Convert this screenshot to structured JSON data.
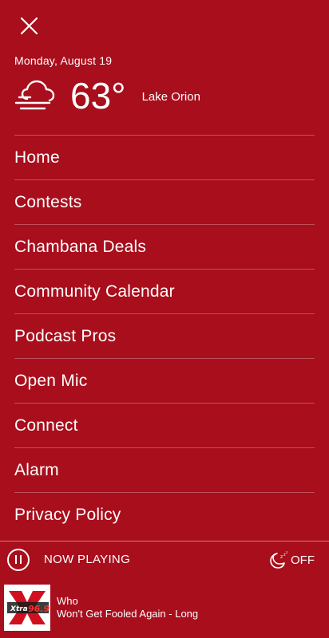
{
  "header": {
    "close_icon": "close-icon"
  },
  "weather": {
    "date": "Monday, August 19",
    "icon": "cloudy-fog-icon",
    "temperature": "63°",
    "location": "Lake Orion"
  },
  "menu": {
    "items": [
      {
        "label": "Home"
      },
      {
        "label": "Contests"
      },
      {
        "label": "Chambana Deals"
      },
      {
        "label": "Community Calendar"
      },
      {
        "label": "Podcast Pros"
      },
      {
        "label": "Open Mic"
      },
      {
        "label": "Connect"
      },
      {
        "label": "Alarm"
      },
      {
        "label": "Privacy Policy"
      }
    ]
  },
  "player": {
    "pause_icon": "pause-icon",
    "now_playing_label": "NOW PLAYING",
    "sleep_icon": "sleep-moon-icon",
    "sleep_label": "OFF",
    "station_logo_text": "Xtra 96.9",
    "artist": "Who",
    "title": "Won't Get Fooled Again - Long"
  },
  "colors": {
    "background": "#a80e1c",
    "text": "#ffffff"
  }
}
